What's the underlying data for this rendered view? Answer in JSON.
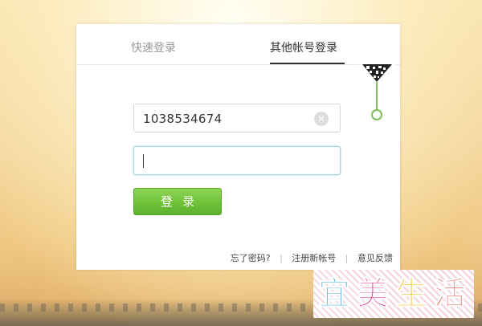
{
  "tabs": {
    "quick_login": "快速登录",
    "other_account_login": "其他帐号登录"
  },
  "account_field": {
    "value": "1038534674"
  },
  "password_field": {
    "value": ""
  },
  "login_button": {
    "label": "登录"
  },
  "footer_links": {
    "forgot_password": "忘了密码?",
    "register": "注册新帐号",
    "feedback": "意见反馈"
  },
  "watermark": {
    "chars": [
      "宜",
      "美",
      "生",
      "活"
    ],
    "colors": [
      "#2a9fd6",
      "#e4007f",
      "#f3b700",
      "#e63e2f"
    ]
  },
  "colors": {
    "accent_green": "#6fc23a",
    "tab_active": "#333333",
    "tab_inactive": "#9a9a9a"
  }
}
